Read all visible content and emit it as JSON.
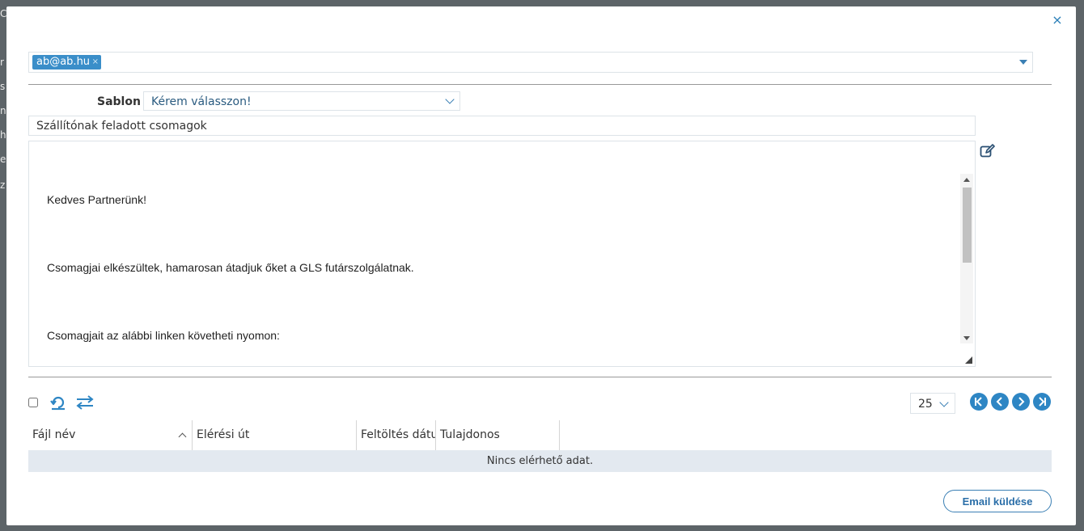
{
  "backdrop": {
    "edge_letters": [
      "C",
      "r",
      "s",
      "n",
      "h",
      "e",
      "z"
    ]
  },
  "dialog": {
    "close_glyph": "×",
    "recipients": {
      "chips": [
        {
          "label": "ab@ab.hu",
          "remove_glyph": "×"
        }
      ]
    },
    "template": {
      "label": "Sablon",
      "selected": "Kérem válasszon!"
    },
    "subject": {
      "value": "Szállítónak feladott csomagok"
    },
    "body": {
      "lines": [
        "Kedves Partnerünk!",
        "Csomagjai elkészültek, hamarosan átadjuk őket a GLS futárszolgálatnak.",
        "Csomagjait az alábbi linken követheti nyomon:"
      ]
    },
    "attachments": {
      "page_size": "25",
      "columns": [
        {
          "label": "Fájl név",
          "sorted": "asc"
        },
        {
          "label": "Elérési út"
        },
        {
          "label": "Feltöltés dátuma"
        },
        {
          "label": "Tulajdonos"
        }
      ],
      "empty_text": "Nincs elérhető adat."
    },
    "send_label": "Email küldése"
  },
  "colors": {
    "accent": "#2e86c4",
    "chip_bg": "#3a8ec9",
    "no_data_bg": "#e3e9f0",
    "backdrop": "#5d6468"
  },
  "icons": {
    "close": "close-icon",
    "chip_remove": "remove-chip-icon",
    "dropdown": "chevron-down-icon",
    "edit": "edit-icon",
    "refresh": "refresh-icon",
    "swap": "swap-icon",
    "pager": [
      "first-page-icon",
      "prev-page-icon",
      "next-page-icon",
      "last-page-icon"
    ],
    "sort": "sort-asc-icon",
    "resize": "resize-grip-icon"
  }
}
